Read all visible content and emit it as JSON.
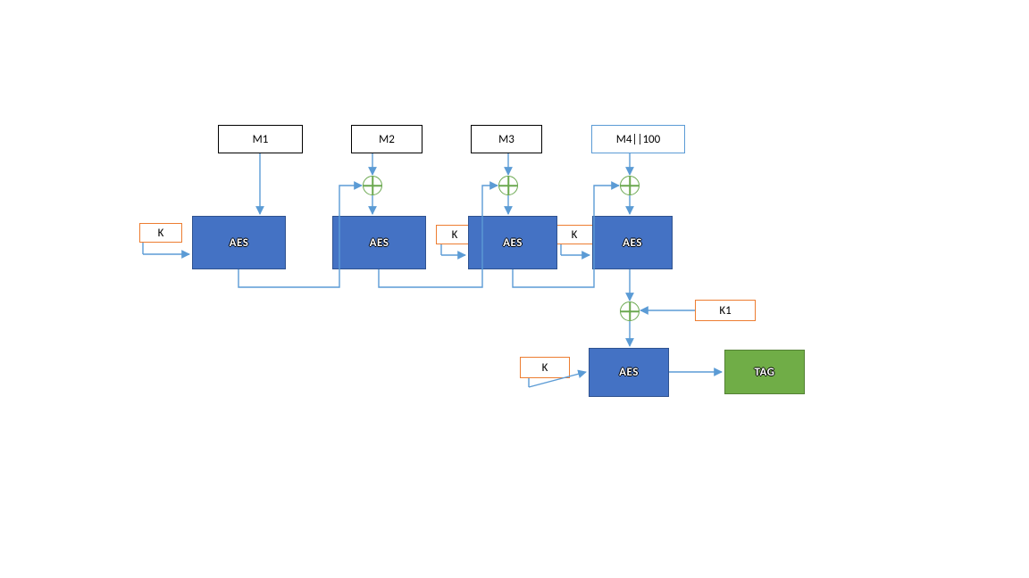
{
  "messages": {
    "m1": "M1",
    "m2": "M2",
    "m3": "M3",
    "m4": "M4||100"
  },
  "keys": {
    "k": "K",
    "k1": "K1"
  },
  "blocks": {
    "aes": "AES",
    "tag": "TAG"
  },
  "colors": {
    "aes_fill": "#4472c4",
    "aes_stroke": "#2f528f",
    "tag_fill": "#70ad47",
    "tag_stroke": "#548235",
    "arrow": "#5b9bd5",
    "orange": "#ed7d31",
    "xor": "#6aa84f"
  }
}
